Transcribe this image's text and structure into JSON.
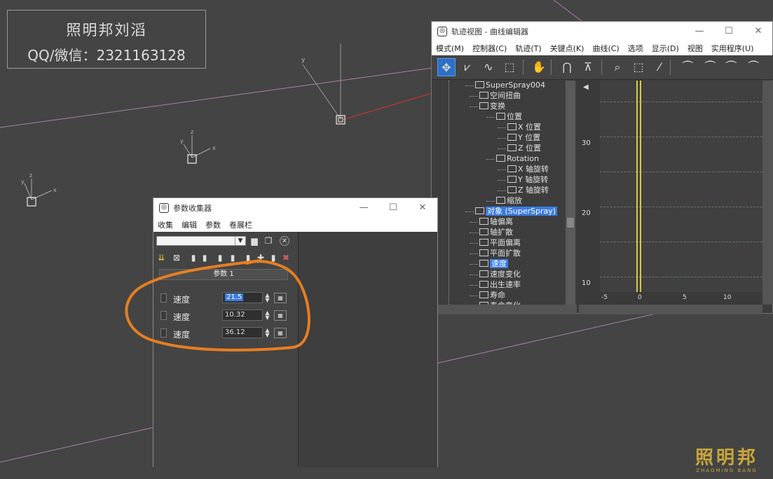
{
  "watermark": {
    "line1": "照明邦刘滔",
    "line2": "QQ/微信：2321163128"
  },
  "logo": {
    "cn": "照明邦",
    "en": "ZHAOMING BANG"
  },
  "viewport": {
    "axis_labels": {
      "x": "x",
      "y": "y",
      "z": "z"
    }
  },
  "track_view": {
    "title": "轨迹视图 - 曲线编辑器",
    "controls": {
      "min": "—",
      "max": "☐",
      "close": "✕"
    },
    "menu": [
      "模式(M)",
      "控制器(C)",
      "轨迹(T)",
      "关键点(K)",
      "曲线(C)",
      "选项",
      "显示(D)",
      "视图",
      "实用程序(U)"
    ],
    "toolbar": [
      "move-keys-icon",
      "draw-curves-icon",
      "add-key-icon",
      "region-select-icon",
      "pan-icon",
      "fit-curve-icon",
      "frame-horizontal-icon",
      "zoom-icon",
      "zoom-region-icon",
      "isolate-curve-icon",
      "tangent-auto-icon",
      "tangent-spline-icon",
      "tangent-fast-icon",
      "tangent-slow-icon"
    ],
    "tree": [
      {
        "label": "SuperSpray004",
        "indent": 0
      },
      {
        "label": "空间扭曲",
        "indent": 1
      },
      {
        "label": "变换",
        "indent": 1
      },
      {
        "label": "位置",
        "indent": 2
      },
      {
        "label": "X 位置",
        "indent": 3
      },
      {
        "label": "Y 位置",
        "indent": 3
      },
      {
        "label": "Z 位置",
        "indent": 3
      },
      {
        "label": "Rotation",
        "indent": 2
      },
      {
        "label": "X 轴旋转",
        "indent": 3
      },
      {
        "label": "Y 轴旋转",
        "indent": 3
      },
      {
        "label": "Z 轴旋转",
        "indent": 3
      },
      {
        "label": "缩放",
        "indent": 2
      },
      {
        "label": "对象 (SuperSpray)",
        "indent": 0,
        "selected": true
      },
      {
        "label": "轴偏离",
        "indent": 1
      },
      {
        "label": "轴扩散",
        "indent": 1
      },
      {
        "label": "平面偏离",
        "indent": 1
      },
      {
        "label": "平面扩散",
        "indent": 1
      },
      {
        "label": "速度",
        "indent": 1,
        "selected": true
      },
      {
        "label": "速度变化",
        "indent": 1
      },
      {
        "label": "出生速率",
        "indent": 1
      },
      {
        "label": "寿命",
        "indent": 1
      },
      {
        "label": "寿命变化",
        "indent": 1
      }
    ],
    "graph": {
      "y_labels": [
        "30",
        "20",
        "10"
      ],
      "x_labels": [
        "-5",
        "0",
        "5",
        "10"
      ]
    },
    "colors": {
      "accent": "#3a7be0",
      "curve": "#d8c84a"
    }
  },
  "param_collector": {
    "title": "参数收集器",
    "controls": {
      "min": "—",
      "max": "☐",
      "close": "✕"
    },
    "menu": [
      "收集",
      "编辑",
      "参数",
      "卷展栏"
    ],
    "rollout_title": "参数 1",
    "params": [
      {
        "label": "速度",
        "value": "21.5",
        "highlight": true
      },
      {
        "label": "速度",
        "value": "10.32",
        "highlight": false
      },
      {
        "label": "速度",
        "value": "36.12",
        "highlight": false
      }
    ],
    "annotation_color": "#e67e22"
  }
}
